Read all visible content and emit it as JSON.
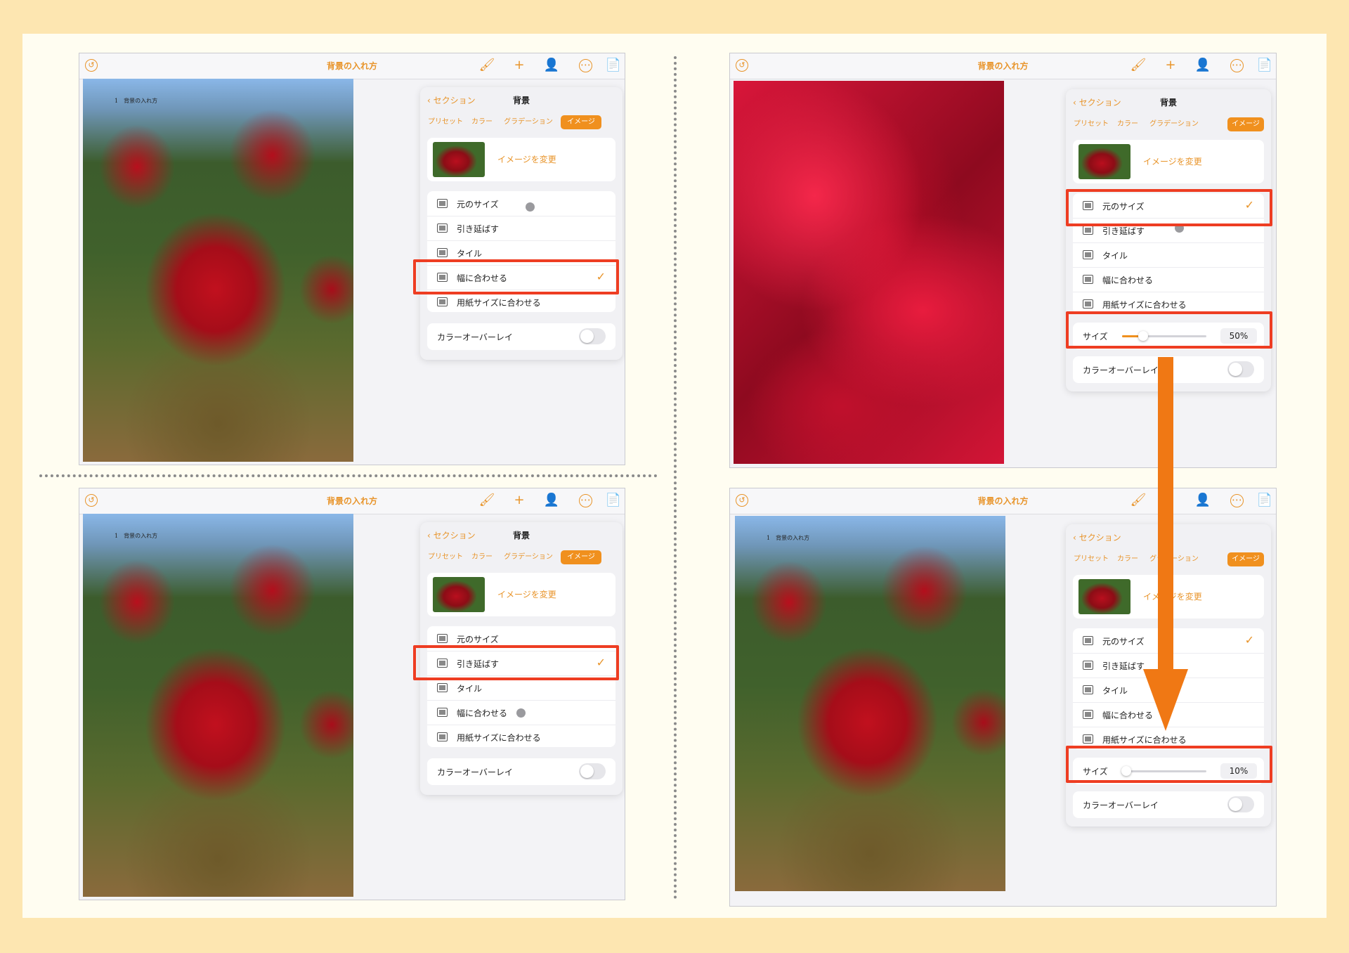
{
  "common": {
    "doc_title": "背景の入れ方",
    "page_header": "1　背景の入れ方",
    "tools": {
      "brush": "🖌",
      "plus": "+",
      "collab": "👤",
      "more": "⋯",
      "doc": "📄"
    },
    "back_glyph": "↺",
    "popover": {
      "back_label": "セクション",
      "title": "背景",
      "tabs": [
        "プリセット",
        "カラー",
        "グラデーション",
        "イメージ"
      ],
      "active_tab": "イメージ",
      "change_image_label": "イメージを変更",
      "options": [
        "元のサイズ",
        "引き延ばす",
        "タイル",
        "幅に合わせる",
        "用紙サイズに合わせる"
      ],
      "overlay_label": "カラーオーバーレイ",
      "size_label": "サイズ"
    },
    "colors": {
      "accent": "#f0901e",
      "highlight": "#ee3d22",
      "arrow": "#f07814"
    }
  },
  "panels": [
    {
      "id": "top-left",
      "checked_option": "幅に合わせる"
    },
    {
      "id": "bottom-left",
      "checked_option": "引き延ばす"
    },
    {
      "id": "top-right",
      "checked_option": "元のサイズ",
      "size_value": "50%",
      "size_fraction": 0.25
    },
    {
      "id": "bottom-right",
      "checked_option": "元のサイズ",
      "size_value": "10%",
      "size_fraction": 0.05
    }
  ]
}
